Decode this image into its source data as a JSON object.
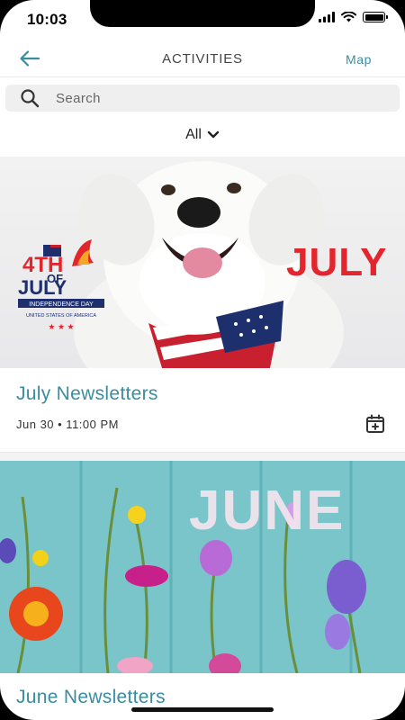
{
  "status_bar": {
    "time": "10:03"
  },
  "header": {
    "title": "ACTIVITIES",
    "map_label": "Map"
  },
  "search": {
    "placeholder": "Search"
  },
  "filter": {
    "label": "All"
  },
  "activities": [
    {
      "title": "July Newsletters",
      "date": "Jun 30 • 11:00 PM",
      "image_text": "JULY",
      "badge": {
        "line1": "4TH",
        "line2": "OF",
        "line3": "JULY",
        "line4": "INDEPENDENCE DAY",
        "line5": "UNITED STATES OF AMERICA"
      }
    },
    {
      "title": "June Newsletters",
      "image_text": "JUNE"
    }
  ],
  "colors": {
    "accent": "#3a8da0",
    "july_red": "#e3262e",
    "june_text": "#f6e4ee"
  }
}
